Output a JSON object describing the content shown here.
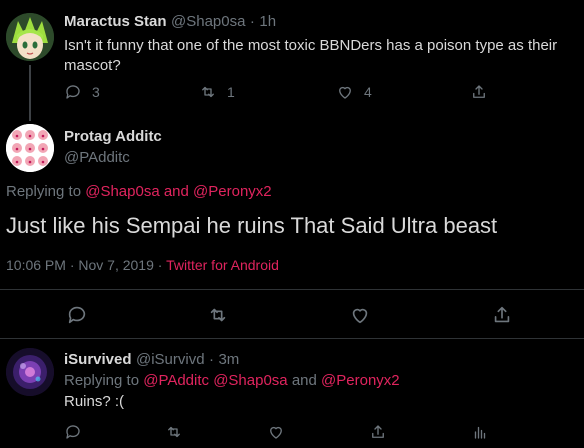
{
  "colors": {
    "accent": "#e0245e",
    "muted": "#6e767d",
    "text": "#d9d9d9",
    "bg": "#000000"
  },
  "tweet1": {
    "author": "Maractus Stan",
    "handle": "@Shap0sa",
    "dot": "·",
    "time": "1h",
    "text": "Isn't it funny that one of the most toxic BBNDers has a poison type as their mascot?",
    "replies": "3",
    "retweets": "1",
    "likes": "4"
  },
  "main": {
    "author": "Protag Additc",
    "handle": "@PAdditc",
    "replying_prefix": "Replying to",
    "reply_user1": "@Shap0sa",
    "and": "and",
    "reply_user2": "@Peronyx2",
    "text": "Just like his Sempai he ruins That Said Ultra beast",
    "timestamp": "10:06 PM · Nov 7, 2019 ·",
    "source": "Twitter for Android"
  },
  "reply": {
    "author": "iSurvived",
    "handle": "@iSurvivd",
    "dot": "·",
    "time": "3m",
    "replying_prefix": "Replying to",
    "user1": "@PAdditc",
    "user2": "@Shap0sa",
    "and": "and",
    "user3": "@Peronyx2",
    "text": "Ruins? :("
  },
  "icons": [
    "reply-icon",
    "retweet-icon",
    "like-icon",
    "share-icon",
    "analytics-icon"
  ]
}
